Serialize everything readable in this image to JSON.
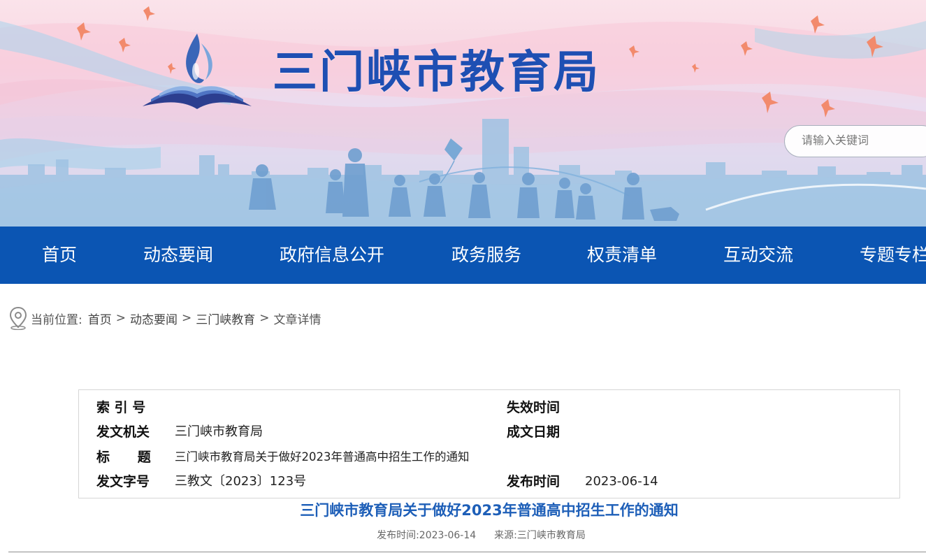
{
  "header": {
    "site_title": "三门峡市教育局",
    "search_placeholder": "请输入关键词"
  },
  "nav": {
    "items": [
      {
        "label": "首页"
      },
      {
        "label": "动态要闻"
      },
      {
        "label": "政府信息公开"
      },
      {
        "label": "政务服务"
      },
      {
        "label": "权责清单"
      },
      {
        "label": "互动交流"
      },
      {
        "label": "专题专栏"
      }
    ]
  },
  "breadcrumb": {
    "prefix": "当前位置:",
    "items": [
      "首页",
      "动态要闻",
      "三门峡教育"
    ],
    "current": "文章详情",
    "separator": ">"
  },
  "meta_table": {
    "index_label": "索 引 号",
    "index_value": "",
    "expire_label": "失效时间",
    "expire_value": "",
    "issuer_label": "发文机关",
    "issuer_value": "三门峡市教育局",
    "written_label": "成文日期",
    "written_value": "",
    "title_label": "标      题",
    "title_value": "三门峡市教育局关于做好2023年普通高中招生工作的通知",
    "docno_label": "发文字号",
    "docno_value": "三教文〔2023〕123号",
    "publish_label": "发布时间",
    "publish_value": "2023-06-14"
  },
  "article": {
    "title": "三门峡市教育局关于做好2023年普通高中招生工作的通知",
    "publish_time": "发布时间:2023-06-14",
    "source": "来源:三门峡市教育局"
  },
  "colors": {
    "nav_bg": "#0b55b3",
    "title_blue": "#1e4fb3",
    "article_title": "#1e5fb8"
  }
}
